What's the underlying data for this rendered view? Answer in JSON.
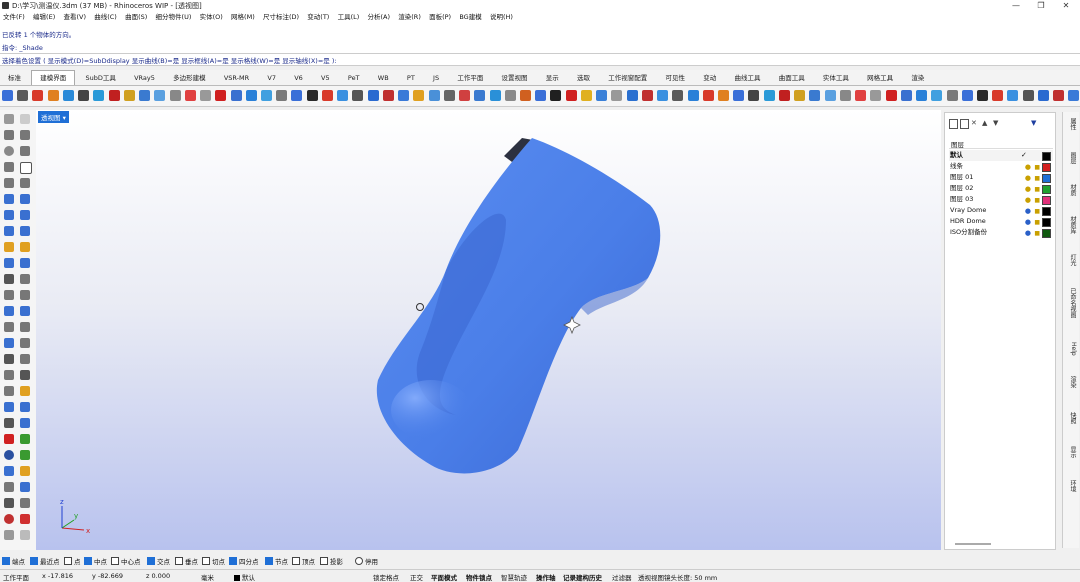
{
  "window": {
    "title": "D:\\学习\\测温仪.3dm (37 MB) - Rhinoceros WIP - [透视图]",
    "minimize": "—",
    "maximize": "❐",
    "close": "✕"
  },
  "menu": [
    "文件(F)",
    "编辑(E)",
    "查看(V)",
    "曲线(C)",
    "曲面(S)",
    "细分物件(U)",
    "实体(O)",
    "网格(M)",
    "尺寸标注(D)",
    "变动(T)",
    "工具(L)",
    "分析(A)",
    "渲染(R)",
    "面板(P)",
    "BG建模",
    "说明(H)"
  ],
  "history": {
    "line1": "已反转 1 个物体的方向。",
    "line2": "指令: _Shade"
  },
  "command": "选择着色设置 ( 显示模式(D)=SubDdisplay  显示曲线(B)=是  显示框线(A)=是  显示格线(W)=是  显示轴线(X)=是 ):",
  "tabs": [
    "标准",
    "建模界面",
    "SubD工具",
    "VRay5",
    "多边形建模",
    "VSR-MR",
    "V7",
    "V6",
    "V5",
    "PeT",
    "WB",
    "PT",
    "JS",
    "工作平面",
    "设置视图",
    "显示",
    "选取",
    "工作视窗配置",
    "可见性",
    "变动",
    "曲线工具",
    "曲面工具",
    "实体工具",
    "网格工具",
    "渲染"
  ],
  "active_tab": "建模界面",
  "viewport": {
    "label": "透视图",
    "axis_x": "x",
    "axis_y": "y",
    "axis_z": "z"
  },
  "layers": {
    "header": "图层",
    "rows": [
      {
        "name": "默认",
        "check": "✓",
        "color": "#000000",
        "current": true
      },
      {
        "name": "线条",
        "color": "#d42020"
      },
      {
        "name": "图层 01",
        "color": "#1f6fd6"
      },
      {
        "name": "图层 02",
        "color": "#1fa030"
      },
      {
        "name": "图层 03",
        "color": "#e0307a"
      },
      {
        "name": "Vray Dome",
        "color": "#000000"
      },
      {
        "name": "HDR Dome",
        "color": "#000000"
      },
      {
        "name": "ISO分割备份",
        "color": "#105a10"
      }
    ]
  },
  "side_tabs": [
    "属性",
    "图层",
    "材质",
    "材质库",
    "灯光",
    "已命名视图",
    "Help",
    "渲染",
    "快照",
    "显示",
    "环境"
  ],
  "osnap": [
    {
      "label": "端点",
      "on": true
    },
    {
      "label": "最近点",
      "on": true
    },
    {
      "label": "点",
      "on": false
    },
    {
      "label": "中点",
      "on": true
    },
    {
      "label": "中心点",
      "on": false
    },
    {
      "label": "交点",
      "on": true
    },
    {
      "label": "垂点",
      "on": false
    },
    {
      "label": "切点",
      "on": false
    },
    {
      "label": "四分点",
      "on": true
    },
    {
      "label": "节点",
      "on": true
    },
    {
      "label": "顶点",
      "on": false
    },
    {
      "label": "投影",
      "on": false
    },
    {
      "label": "停用",
      "on": false
    }
  ],
  "status": {
    "plane": "工作平面",
    "x": "x -17.816",
    "y": "y -82.669",
    "z": "z 0.000",
    "unit": "毫米",
    "layer": "默认",
    "grid_snap": "锁定格点",
    "ortho": "正交",
    "planar": "平面模式",
    "osnap": "物件锁点",
    "smarttrack": "智慧轨迹",
    "gumball": "操作轴",
    "history": "记录建构历史",
    "filter": "过滤器",
    "lens": "透视视图镜头长度: 50 mm"
  }
}
